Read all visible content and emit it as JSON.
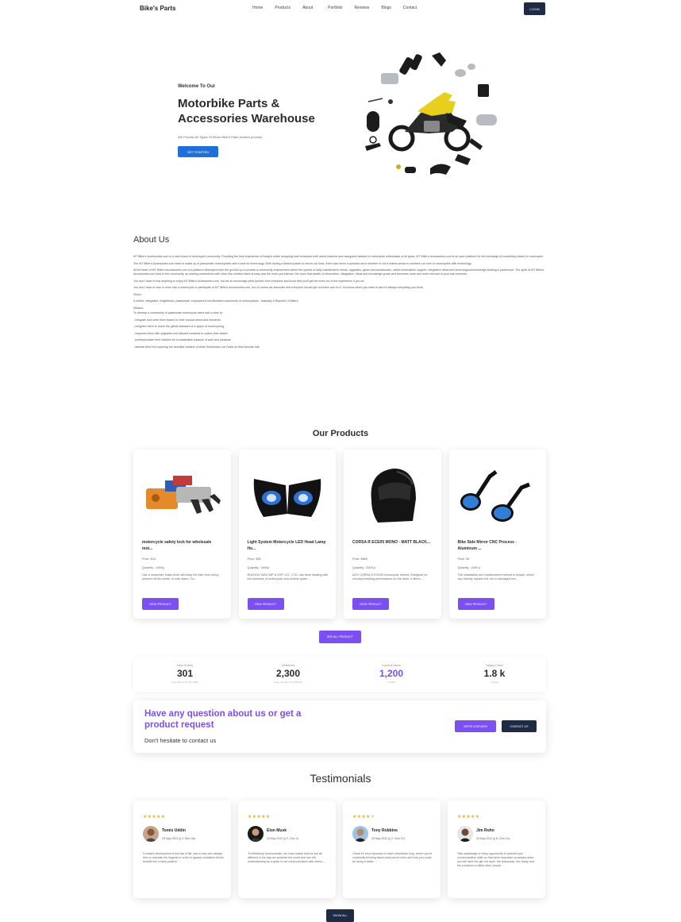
{
  "nav": {
    "brand": "Bike's Parts",
    "links": [
      "Home",
      "Products",
      "About",
      "Portfolio",
      "Reviews",
      "Blogs",
      "Contact"
    ],
    "login": "LOGIN"
  },
  "hero": {
    "welcome": "Welcome To Our",
    "title": "Motorbike Parts & Accessories Warehouse",
    "subtitle": "We Provide All Types Of Motor Bike's Parts shorted process",
    "button": "GET STARTED"
  },
  "about": {
    "title": "About Us",
    "paragraphs": [
      "MT iBike's Accessories.com is a new brand of motorcycle community. Providing the best experience of today's online shopping mall enhanced with useful features and categories tailored to motorcycle enthusiasts of all types, MT iBike's Accessories.com is an open platform for the exchange of everything related to motorcycle.",
      "The MT iBike's Accessories.com team is made up of passionate motorcyclists with a zeal for technology. Both having a shared power to enrich our lives, there was never a question as to whether or not it makes sense to combine our love of motorcycles with technology.",
      "At the heart of MT iBike's Accessories.com is a platform developed from the ground up to provide a community environment where the spread of daily maintenance needs, upgrades, gears and accessories, useful information/ support, integration ideas and technological knowledge sharing is paramount. The spirit of MT iBike's Accessories.com lives in the community, as making connections with other like-minded riders is easy and the more you interact, the more that wealth of information, integration, ideas and knowledge grows and becomes more and more relevant to your own interests.",
      "You don't have to buy anything to enjoy MT iBike's Accessories.com, but we do encourage parts ijection from everyone and know that you'll get far more out of the experience if you do.",
      "You don't have to own or even ride a motorcycle to participate in MT iBike's Accessories.com, but of course we advocate that everyone should get out there and do it. You know when you want to ask it's always everything you think.",
      "Vision:",
      "A united, integrated, enlightened, passionate, empowered and liberated community of motorcyclists - basically a Republic of Bikers.",
      "Mission:",
      "To develop a community of passionate motorcycle users with a view to:",
      "- integrate and unite them based on their mutual needs and demands",
      "- enlighten them to reach the global standard of a space of motorcycling",
      "- empower them with upgrades and tailored solutions to realize their desire",
      "- professionalize their hobbies for a sustainable balance of work and pleasure",
      "- liberate them for exploring the beautiful creation of Allah Subhanahu wa Ta'ala on their favorite ride"
    ]
  },
  "products": {
    "title": "Our Products",
    "items": [
      {
        "name": "motorcycle safety lock for wholesale mot...",
        "price": "Price: $15",
        "qty": "Quantity : 1950p",
        "desc": "Use a motorbike brake lever will keep the bike from being pushed off the center or side stand. Ca...",
        "button": "VIEW PRODUCT",
        "icon": "lock-set-image"
      },
      {
        "name": "Light System Motorcycle LED Head Lamp Ho...",
        "price": "Price: $36",
        "qty": "Quantity : 1600p",
        "desc": "RUZHOU WAZ IMP & EXP. CO., LTD. has been dealing with the business of motorcycle and vehicle spare ...",
        "button": "VIEW PRODUCT",
        "icon": "headlamp-image"
      },
      {
        "name": "CORSA R ECE05 MONO - MATT BLACK...",
        "price": "Price: $850",
        "qty": "Quantity : 2000 p",
        "desc": "AGV CORSA R ECE05 motorcycle helmet. Designed for uncompromising performance on the track, it offers ...",
        "button": "VIEW PRODUCT",
        "icon": "helmet-image"
      },
      {
        "name": "Bike Side Mirror CNC Process - Aluminum ...",
        "price": "Price: $2",
        "qty": "Quantity : 2000 p",
        "desc": "The installation and replacement method is simple, which can directly replace the old or damaged rea...",
        "button": "VIEW PRODUCT",
        "icon": "mirror-image"
      }
    ],
    "see_all": "SEE ALL PRODUCT"
  },
  "stats": [
    {
      "label": "New Orders",
      "value": "301",
      "note": "From March To July 2022",
      "purple": false
    },
    {
      "label": "Delivered",
      "value": "2,300",
      "note": "From January To 6 Months",
      "purple": false
    },
    {
      "label": "Current Users",
      "value": "1,200",
      "note": "In 2022",
      "purple": true
    },
    {
      "label": "Happy Client",
      "value": "1.8 k",
      "note": "+ 30 Hrs",
      "purple": false
    }
  ],
  "cta": {
    "question": "Have any question about us or get a product request",
    "sub": "Don't hesitate to contact us",
    "write_review": "WRITE A REVIEW",
    "contact": "CONTACT US"
  },
  "testimonials": {
    "title": "Testimonials",
    "items": [
      {
        "stars": 5,
        "name": "Tomis Uddin",
        "date": "25 May 2022 ||| 3: 56m 34s",
        "text": "Constant development is the law of life, and a man who always tries to maintain his dogmas in order to appear consistent drives himself into a false position. ..."
      },
      {
        "stars": 5,
        "name": "Elon Musk",
        "date": "25 May 2022 ||| 9: 23m 7s",
        "text": "To effectively communicate, we must realize that we are all different in the way we perceive the world and use this understanding as a guide to our communication with others. ..."
      },
      {
        "stars": 4,
        "name": "Tony Robbins",
        "date": "25 May 2022 ||| 3: 34m 47s",
        "text": "I think it's very important to have a feedback loop, where you're constantly thinking about what you've done and how you could be doing it better. ..."
      },
      {
        "stars": 5,
        "name": "Jim Rohn",
        "date": "25 May 2022 ||| 8: 23m 10s",
        "text": "Take advantage of every opportunity to practice your communication skills so that when important occasions arise, you will have the gift, the style, the sharpness, the clarity, and the emotions to affect other people. ..."
      }
    ],
    "show_all": "SHOW ALL"
  },
  "colors": {
    "accent": "#7b4ff0",
    "navy": "#1f2a44",
    "hero_button": "#1e6fd9",
    "star": "#f2b01e"
  }
}
